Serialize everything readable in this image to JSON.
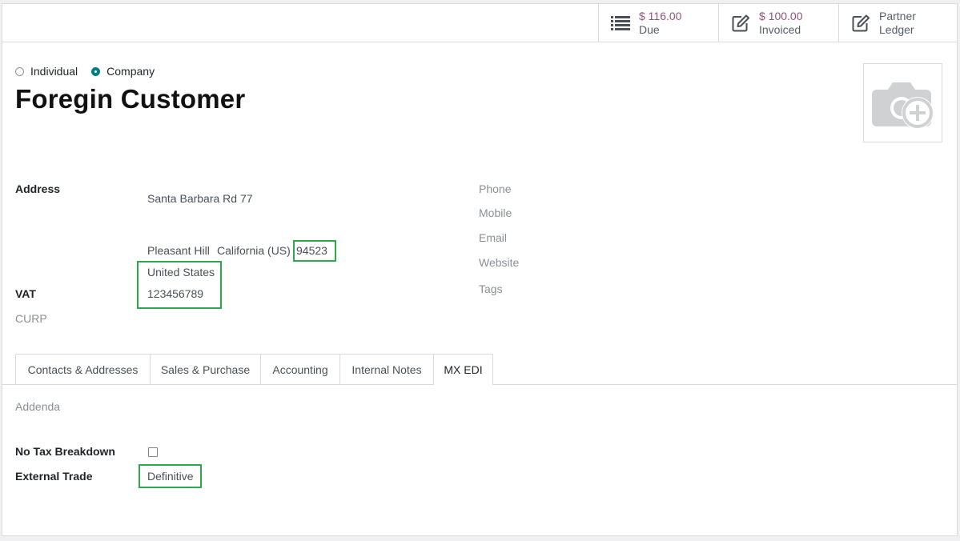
{
  "smart_buttons": {
    "due": {
      "value": "$ 116.00",
      "label": "Due",
      "icon": "list-icon"
    },
    "invoiced": {
      "value": "$ 100.00",
      "label": "Invoiced",
      "icon": "pencil-square-icon"
    },
    "ledger": {
      "line1": "Partner",
      "line2": "Ledger",
      "icon": "pencil-square-icon"
    }
  },
  "company_type": {
    "options": [
      "Individual",
      "Company"
    ],
    "selected": "Company"
  },
  "partner_name": "Foregin Customer",
  "address": {
    "label": "Address",
    "street": "Santa Barbara Rd  77",
    "city": "Pleasant Hill",
    "state": "California (US)",
    "zip": "94523",
    "country": "United States"
  },
  "vat": {
    "label": "VAT",
    "value": "123456789"
  },
  "curp": {
    "label": "CURP"
  },
  "contact_labels": {
    "phone": "Phone",
    "mobile": "Mobile",
    "email": "Email",
    "website": "Website",
    "tags": "Tags"
  },
  "tabs": [
    {
      "label": "Contacts & Addresses"
    },
    {
      "label": "Sales & Purchase"
    },
    {
      "label": "Accounting"
    },
    {
      "label": "Internal Notes"
    },
    {
      "label": "MX EDI",
      "active": true
    }
  ],
  "mx_edi": {
    "addenda_label": "Addenda",
    "no_tax_breakdown_label": "No Tax Breakdown",
    "no_tax_breakdown_checked": false,
    "external_trade_label": "External Trade",
    "external_trade_value": "Definitive"
  },
  "colors": {
    "accent": "#017e84",
    "smart_value": "#8f5579",
    "highlight": "#2ea84c"
  }
}
